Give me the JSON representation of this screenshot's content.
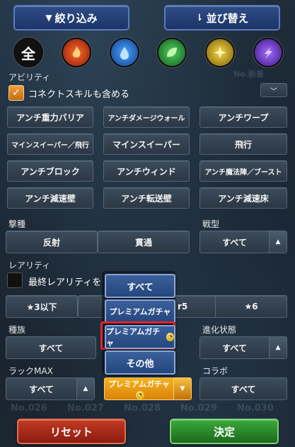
{
  "header": {
    "filter_label": "絞り込み",
    "sort_label": "並び替え"
  },
  "background": {
    "no_label": "No.新着",
    "numbers": [
      "No.026",
      "No.027",
      "No.028",
      "No.029",
      "No.030"
    ]
  },
  "elements": [
    {
      "name": "all",
      "glyph": "全",
      "color": "#111111"
    },
    {
      "name": "fire",
      "glyph": "",
      "color": "#c8401e"
    },
    {
      "name": "water",
      "glyph": "",
      "color": "#2a6fc9"
    },
    {
      "name": "wood",
      "glyph": "",
      "color": "#2f8f3c"
    },
    {
      "name": "light",
      "glyph": "",
      "color": "#c8a020"
    },
    {
      "name": "dark",
      "glyph": "",
      "color": "#6a34b8"
    }
  ],
  "ability": {
    "label": "アビリティ",
    "connect_skill_label": "コネクトスキルも含める",
    "options": [
      "アンチ重力バリア",
      "アンチダメージウォール",
      "アンチワープ",
      "マインスイーパー／飛行",
      "マインスイーパー",
      "飛行",
      "アンチブロック",
      "アンチウィンド",
      "アンチ魔法陣／ブースト",
      "アンチ減速壁",
      "アンチ転送壁",
      "アンチ減速床"
    ]
  },
  "attack_type": {
    "label": "撃種",
    "options": [
      "反射",
      "貫通"
    ]
  },
  "battle_type": {
    "label": "戦型",
    "value": "すべて"
  },
  "rarity": {
    "label": "レアリティ",
    "final_rarity_label": "最終レアリティを",
    "options": [
      "★3以下",
      "r5",
      "★6"
    ]
  },
  "race": {
    "label": "種族",
    "value": "すべて"
  },
  "evolution": {
    "label": "進化状態",
    "value": "すべて"
  },
  "luck_max": {
    "label": "ラックMAX",
    "value": "すべて"
  },
  "gacha": {
    "value": "プレミアムガチャ"
  },
  "collab": {
    "label": "コラボ",
    "value": "すべて"
  },
  "dropdown": {
    "options": [
      "すべて",
      "プレミアムガチャ",
      "プレミアムガチャ",
      "その他"
    ],
    "selected_index": 2,
    "highlight_color": "#e8232a"
  },
  "footer": {
    "reset_label": "リセット",
    "confirm_label": "決定"
  }
}
